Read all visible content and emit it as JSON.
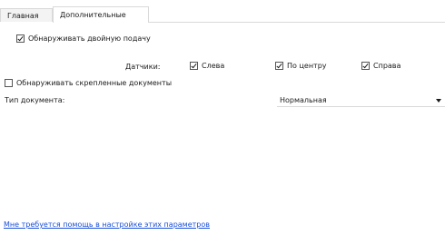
{
  "tabs": [
    {
      "label": "Главная"
    },
    {
      "label": "Дополнительные"
    }
  ],
  "double_feed": {
    "label": "Обнаруживать двойную подачу",
    "checked": true
  },
  "sensors": {
    "label": "Датчики:",
    "left": {
      "label": "Слева",
      "checked": true
    },
    "center": {
      "label": "По центру",
      "checked": true
    },
    "right": {
      "label": "Справа",
      "checked": true
    }
  },
  "stapled": {
    "label": "Обнаруживать скрепленные документы",
    "checked": false
  },
  "doc_type": {
    "label": "Тип документа:",
    "value": "Нормальная"
  },
  "help": {
    "link_text": "Мне требуется помощь в настройке этих параметров"
  }
}
